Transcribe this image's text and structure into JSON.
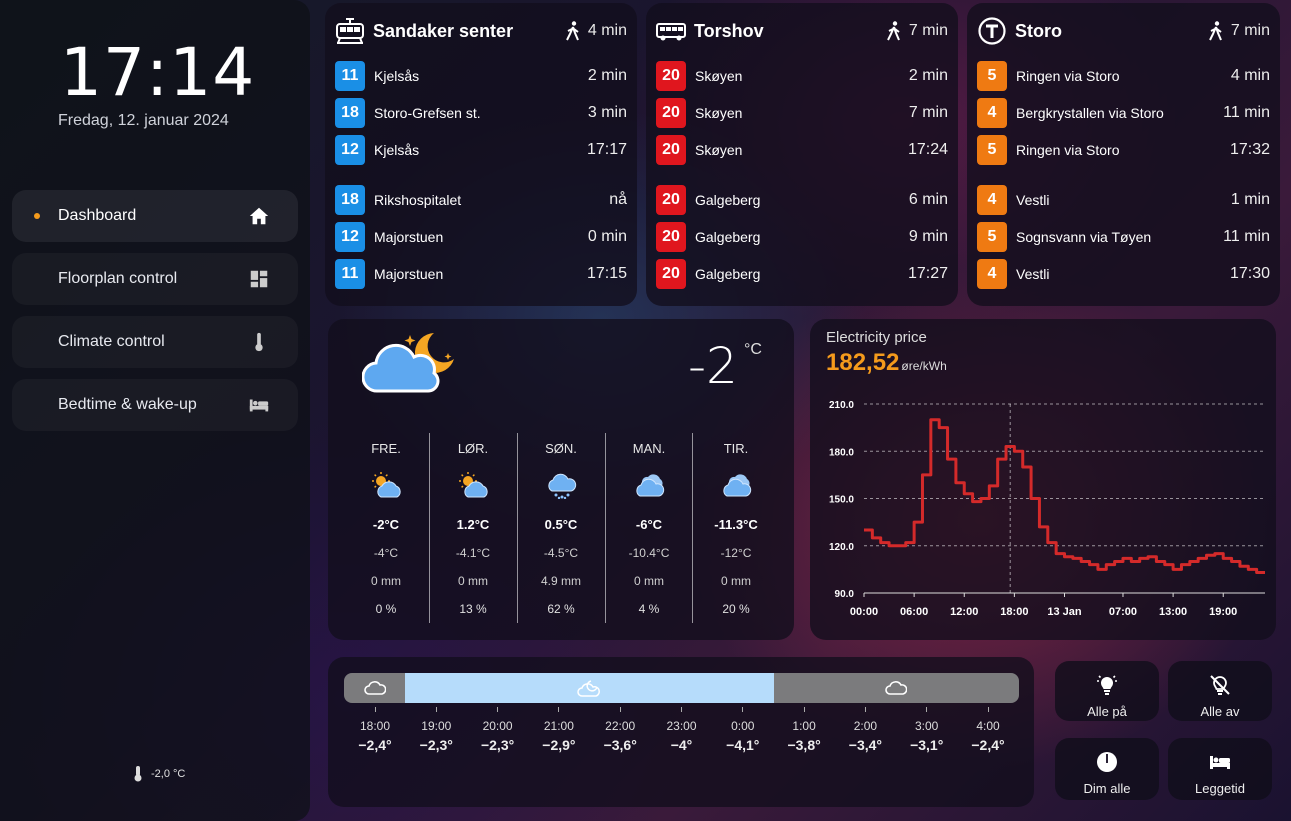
{
  "sidebar": {
    "clock": "17:14",
    "date": "Fredag, 12. januar 2024",
    "nav": [
      {
        "label": "Dashboard",
        "icon": "home-icon",
        "active": true
      },
      {
        "label": "Floorplan control",
        "icon": "dashboard-icon"
      },
      {
        "label": "Climate control",
        "icon": "thermometer-icon"
      },
      {
        "label": "Bedtime & wake-up",
        "icon": "bed-icon"
      }
    ],
    "indoor_temp": "-2,0 °C"
  },
  "transit": [
    {
      "stop": "Sandaker senter",
      "icon": "tram-icon",
      "walk": "4 min",
      "departures": [
        {
          "line": "11",
          "dest": "Kjelsås",
          "time": "2 min"
        },
        {
          "line": "18",
          "dest": "Storo-Grefsen st.",
          "time": "3 min"
        },
        {
          "line": "12",
          "dest": "Kjelsås",
          "time": "17:17"
        },
        {
          "line": "18",
          "dest": "Rikshospitalet",
          "time": "nå"
        },
        {
          "line": "12",
          "dest": "Majorstuen",
          "time": "0 min"
        },
        {
          "line": "11",
          "dest": "Majorstuen",
          "time": "17:15"
        }
      ]
    },
    {
      "stop": "Torshov",
      "icon": "bus-icon",
      "walk": "7 min",
      "departures": [
        {
          "line": "20",
          "dest": "Skøyen",
          "time": "2 min"
        },
        {
          "line": "20",
          "dest": "Skøyen",
          "time": "7 min"
        },
        {
          "line": "20",
          "dest": "Skøyen",
          "time": "17:24"
        },
        {
          "line": "20",
          "dest": "Galgeberg",
          "time": "6 min"
        },
        {
          "line": "20",
          "dest": "Galgeberg",
          "time": "9 min"
        },
        {
          "line": "20",
          "dest": "Galgeberg",
          "time": "17:27"
        }
      ]
    },
    {
      "stop": "Storo",
      "icon": "metro-icon",
      "walk": "7 min",
      "departures": [
        {
          "line": "5",
          "dest": "Ringen via Storo",
          "time": "4 min"
        },
        {
          "line": "4",
          "dest": "Bergkrystallen via Storo",
          "time": "11 min"
        },
        {
          "line": "5",
          "dest": "Ringen via Storo",
          "time": "17:32"
        },
        {
          "line": "4",
          "dest": "Vestli",
          "time": "1 min"
        },
        {
          "line": "5",
          "dest": "Sognsvann via Tøyen",
          "time": "11 min"
        },
        {
          "line": "4",
          "dest": "Vestli",
          "time": "17:30"
        }
      ]
    }
  ],
  "colors": {
    "tram": "#1a8fe6",
    "bus": "#e0161e",
    "metro": "#ef7a12",
    "accent": "#f59b1c",
    "chart_line": "#d42a2a",
    "bar_cloudy": "#7b7b7d",
    "bar_clear": "#b6dcfb"
  },
  "weather": {
    "current_temp": "-2",
    "unit": "°C",
    "current_icon": "partly-cloudy-night-icon",
    "forecast": [
      {
        "day": "FRE.",
        "icon": "partly-sunny-icon",
        "hi": "-2°C",
        "lo": "-4°C",
        "precip": "0 mm",
        "chance": "0 %"
      },
      {
        "day": "LØR.",
        "icon": "partly-sunny-icon",
        "hi": "1.2°C",
        "lo": "-4.1°C",
        "precip": "0 mm",
        "chance": "13 %"
      },
      {
        "day": "SØN.",
        "icon": "snow-icon",
        "hi": "0.5°C",
        "lo": "-4.5°C",
        "precip": "4.9 mm",
        "chance": "62 %"
      },
      {
        "day": "MAN.",
        "icon": "cloudy-icon",
        "hi": "-6°C",
        "lo": "-10.4°C",
        "precip": "0 mm",
        "chance": "4 %"
      },
      {
        "day": "TIR.",
        "icon": "cloudy-icon",
        "hi": "-11.3°C",
        "lo": "-12°C",
        "precip": "0 mm",
        "chance": "20 %"
      }
    ]
  },
  "electricity": {
    "title": "Electricity price",
    "price": "182,52",
    "unit": "øre/kWh"
  },
  "chart_data": {
    "type": "line",
    "title": "Electricity price",
    "ylim": [
      90,
      210
    ],
    "yticks": [
      "210.0",
      "180.0",
      "150.0",
      "120.0",
      "90.0"
    ],
    "ytick_values": [
      210,
      180,
      150,
      120,
      90
    ],
    "xticks": [
      "00:00",
      "06:00",
      "12:00",
      "18:00",
      "13 Jan",
      "07:00",
      "13:00",
      "19:00"
    ],
    "xtick_hours": [
      0,
      6,
      12,
      18,
      24,
      31,
      37,
      43
    ],
    "current_hour": 17,
    "series": [
      {
        "hours": [
          0,
          1,
          2,
          3,
          4,
          5,
          6,
          7,
          8,
          9,
          10,
          11,
          12,
          13,
          14,
          15,
          16,
          17,
          18,
          19,
          20,
          21,
          22,
          23,
          24,
          25,
          26,
          27,
          28,
          29,
          30,
          31,
          32,
          33,
          34,
          35,
          36,
          37,
          38,
          39,
          40,
          41,
          42,
          43,
          44,
          45,
          46,
          47
        ],
        "values": [
          130,
          125,
          122,
          120,
          120,
          122,
          135,
          165,
          200,
          195,
          175,
          160,
          153,
          148,
          150,
          158,
          175,
          183,
          180,
          170,
          150,
          132,
          122,
          115,
          113,
          112,
          110,
          108,
          105,
          108,
          110,
          112,
          110,
          112,
          113,
          110,
          108,
          105,
          108,
          110,
          112,
          114,
          115,
          112,
          110,
          107,
          105,
          103
        ]
      }
    ]
  },
  "hourly": {
    "segments": [
      {
        "icon": "cloud-icon",
        "kind": "cloudy",
        "weight": 1
      },
      {
        "icon": "partly-cloudy-night-icon",
        "kind": "clear",
        "weight": 6
      },
      {
        "icon": "cloud-icon",
        "kind": "cloudy",
        "weight": 4
      }
    ],
    "hours": [
      {
        "time": "18:00",
        "temp": "−2,4°"
      },
      {
        "time": "19:00",
        "temp": "−2,3°"
      },
      {
        "time": "20:00",
        "temp": "−2,3°"
      },
      {
        "time": "21:00",
        "temp": "−2,9°"
      },
      {
        "time": "22:00",
        "temp": "−3,6°"
      },
      {
        "time": "23:00",
        "temp": "−4°"
      },
      {
        "time": "0:00",
        "temp": "−4,1°"
      },
      {
        "time": "1:00",
        "temp": "−3,8°"
      },
      {
        "time": "2:00",
        "temp": "−3,4°"
      },
      {
        "time": "3:00",
        "temp": "−3,1°"
      },
      {
        "time": "4:00",
        "temp": "−2,4°"
      }
    ]
  },
  "lights": [
    {
      "label": "Alle på",
      "icon": "lights-on-icon"
    },
    {
      "label": "Alle av",
      "icon": "lights-off-icon"
    },
    {
      "label": "Dim alle",
      "icon": "dim-icon"
    },
    {
      "label": "Leggetid",
      "icon": "bed-icon"
    }
  ]
}
